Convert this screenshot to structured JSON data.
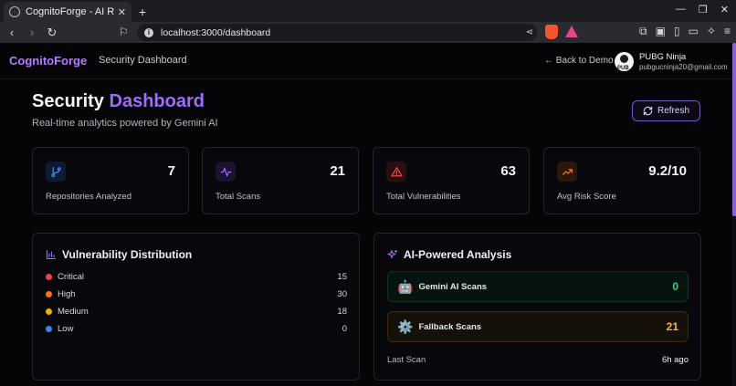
{
  "browser": {
    "tab_title": "CognitoForge - AI Red Te",
    "url": "localhost:3000/dashboard"
  },
  "nav": {
    "brand": "CognitoForge",
    "title": "Security Dashboard",
    "back_label": "Back to Demo",
    "user_name": "PUBG Ninja",
    "user_email": "pubgucninja20@gmail.com",
    "avatar_text": "PUB"
  },
  "header": {
    "title_main": "Security",
    "title_accent": "Dashboard",
    "subtitle": "Real-time analytics powered by Gemini AI",
    "refresh_label": "Refresh"
  },
  "stats": [
    {
      "value": "7",
      "label": "Repositories Analyzed",
      "icon": "git-branch-icon",
      "color": "#4a8cff"
    },
    {
      "value": "21",
      "label": "Total Scans",
      "icon": "activity-icon",
      "color": "#a06bff"
    },
    {
      "value": "63",
      "label": "Total Vulnerabilities",
      "icon": "warning-triangle-icon",
      "color": "#ff4d4d"
    },
    {
      "value": "9.2/10",
      "label": "Avg Risk Score",
      "icon": "trending-up-icon",
      "color": "#ff7a33"
    }
  ],
  "distribution": {
    "title": "Vulnerability Distribution",
    "items": [
      {
        "label": "Critical",
        "count": "15",
        "color": "#ef4444"
      },
      {
        "label": "High",
        "count": "30",
        "color": "#f97316"
      },
      {
        "label": "Medium",
        "count": "18",
        "color": "#eab308"
      },
      {
        "label": "Low",
        "count": "0",
        "color": "#3b82f6"
      }
    ]
  },
  "ai": {
    "title": "AI-Powered Analysis",
    "gemini_label": "Gemini AI Scans",
    "gemini_count": "0",
    "fallback_label": "Fallback Scans",
    "fallback_count": "21",
    "last_scan_label": "Last Scan",
    "last_scan_value": "6h ago"
  }
}
